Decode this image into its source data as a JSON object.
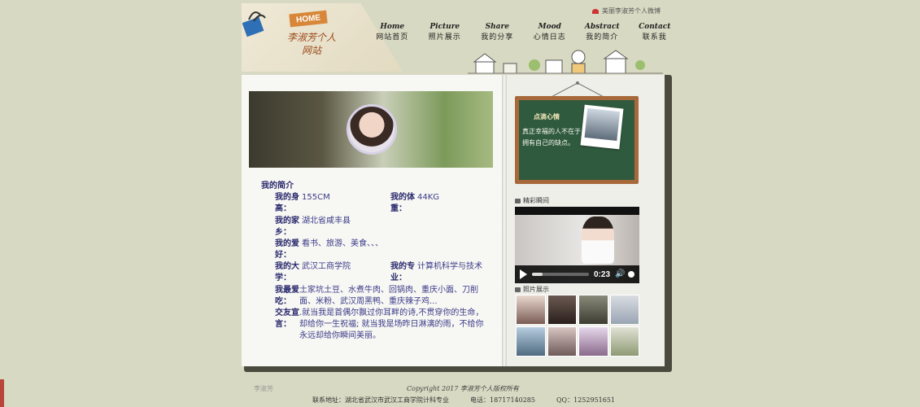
{
  "header": {
    "home_tag": "HOME",
    "site_title": "李淑芳个人网站",
    "fav_text": "美丽李淑芳个人微博"
  },
  "nav": [
    {
      "en": "Home",
      "cn": "网站首页"
    },
    {
      "en": "Picture",
      "cn": "照片展示"
    },
    {
      "en": "Share",
      "cn": "我的分享"
    },
    {
      "en": "Mood",
      "cn": "心情日志"
    },
    {
      "en": "Abstract",
      "cn": "我的简介"
    },
    {
      "en": "Contact",
      "cn": "联系我"
    }
  ],
  "intro": {
    "title": "我的简介",
    "rows": [
      {
        "label": "我的身高：",
        "value": "155CM",
        "label2": "我的体重：",
        "value2": "44KG"
      },
      {
        "label": "我的家乡：",
        "value": "湖北省咸丰县"
      },
      {
        "label": "我的爱好：",
        "value": "看书、旅游、美食、、、"
      },
      {
        "label": "我的大学：",
        "value": "武汉工商学院",
        "label2": "我的专业：",
        "value2": "计算机科学与技术"
      },
      {
        "label": "我最爱吃：",
        "value": "土家坑土豆、水煮牛肉、回锅肉、重庆小面、刀削面、米粉、武汉周黑鸭、重庆辣子鸡..."
      },
      {
        "label": "交友宣言：",
        "value": ".就当我是首偶尔飘过你耳畔的诗,不贯穿你的生命，却给你一生祝福; 就当我是场昨日淋漓的雨，不给你永远却给你瞬间美丽。"
      }
    ]
  },
  "board": {
    "title": "点滴心情",
    "text": "真正幸福的人不在于拥有自己的缺点。"
  },
  "sections": {
    "video_label": "精彩瞬间",
    "gallery_label": "照片展示"
  },
  "video": {
    "time": "0:23",
    "progress": 0.18
  },
  "footer": {
    "copyright": "Copyright 2017 李淑芳个人版权所有",
    "address": "联系地址：湖北省武汉市武汉工商学院计科专业",
    "phone": "电话：18717140285",
    "qq": "QQ：1252951651",
    "logo_text": "李淑芳"
  },
  "colors": {
    "background": "#d8d9c2",
    "accent_text": "#2a2a6e",
    "board_green": "#2f5a3e"
  }
}
